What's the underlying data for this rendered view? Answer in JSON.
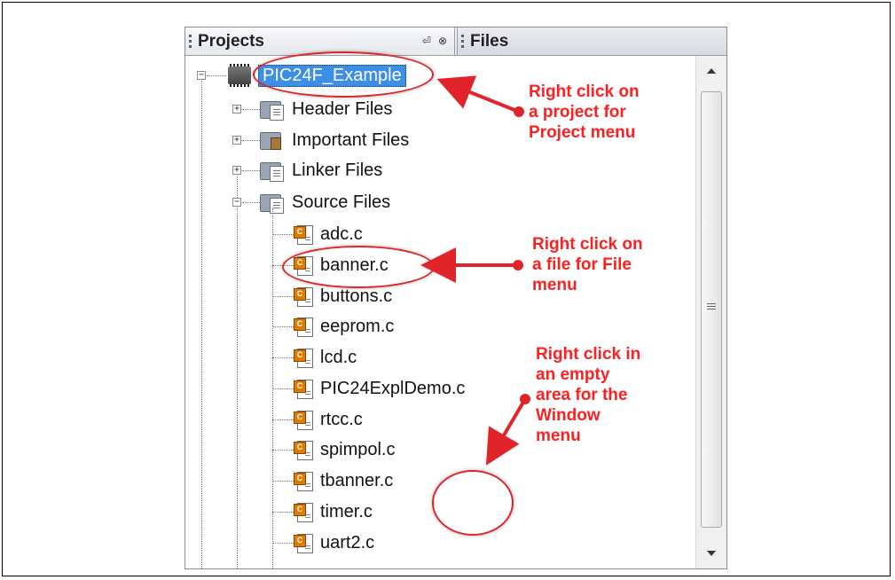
{
  "tabs": {
    "projects": "Projects",
    "files": "Files",
    "pin_glyph": "⏎",
    "close_glyph": "⊗"
  },
  "project": {
    "name": "PIC24F_Example",
    "folders": [
      {
        "label": "Header Files",
        "icon": "folder-doc-icon",
        "expanded": false
      },
      {
        "label": "Important Files",
        "icon": "folder-wrench-icon",
        "expanded": false
      },
      {
        "label": "Linker Files",
        "icon": "folder-doc-icon",
        "expanded": false
      },
      {
        "label": "Source Files",
        "icon": "folder-doc-icon",
        "expanded": true
      }
    ],
    "source_files": [
      "adc.c",
      "banner.c",
      "buttons.c",
      "eeprom.c",
      "lcd.c",
      "PIC24ExplDemo.c",
      "rtcc.c",
      "spimpol.c",
      "tbanner.c",
      "timer.c",
      "uart2.c"
    ]
  },
  "callouts": {
    "project_menu": [
      "Right click on",
      "a project for",
      "Project menu"
    ],
    "file_menu": [
      "Right click on",
      "a file for File",
      "menu"
    ],
    "window_menu": [
      "Right click in",
      "an empty",
      "area for the",
      "Window",
      "menu"
    ]
  },
  "colors": {
    "annotation": "#ff1f1f",
    "selection": "#3d8ee6"
  }
}
